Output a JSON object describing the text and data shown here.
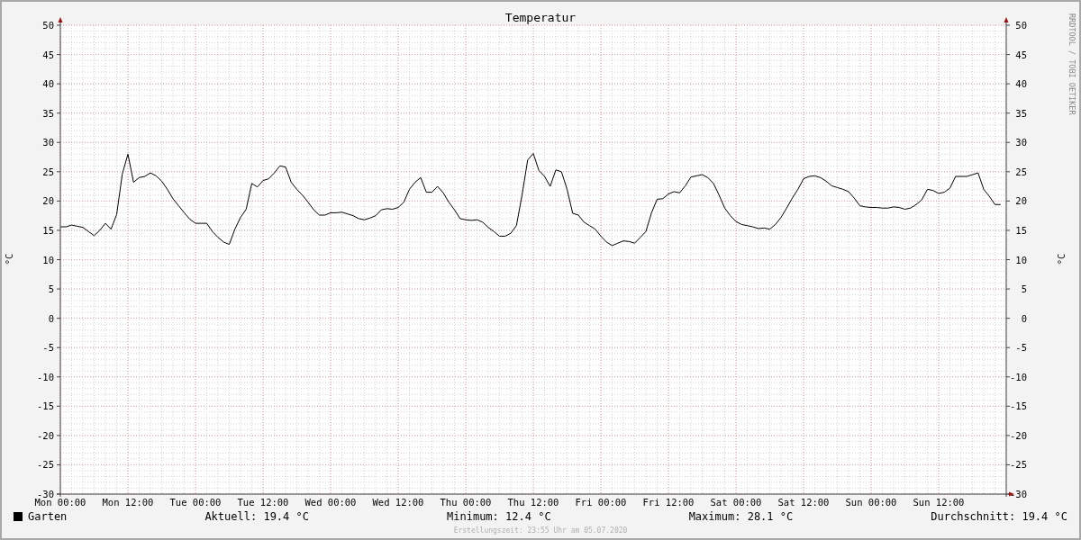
{
  "chart": {
    "watermark": "RRDTOOL / TOBI OETIKER",
    "right_axis": {
      "label": "°C",
      "ticks": [
        "50",
        "45",
        "40",
        "35",
        "30",
        "25",
        "20",
        "15",
        "10",
        "5",
        "0",
        "-5",
        "-10",
        "-15",
        "-20",
        "-25",
        "-30"
      ]
    },
    "chart_data": {
      "type": "line",
      "grid": true,
      "title": "Temperatur",
      "ylabel": "°C",
      "ylim": [
        -30,
        50
      ],
      "yticks": [
        {
          "value": 50,
          "label": "50"
        },
        {
          "value": 45,
          "label": "45"
        },
        {
          "value": 40,
          "label": "40"
        },
        {
          "value": 35,
          "label": "35"
        },
        {
          "value": 30,
          "label": "30"
        },
        {
          "value": 25,
          "label": "25"
        },
        {
          "value": 20,
          "label": "20"
        },
        {
          "value": 15,
          "label": "15"
        },
        {
          "value": 10,
          "label": "10"
        },
        {
          "value": 5,
          "label": "5"
        },
        {
          "value": 0,
          "label": "0"
        },
        {
          "value": -5,
          "label": "-5"
        },
        {
          "value": -10,
          "label": "-10"
        },
        {
          "value": -15,
          "label": "-15"
        },
        {
          "value": -20,
          "label": "-20"
        },
        {
          "value": -25,
          "label": "-25"
        },
        {
          "value": -30,
          "label": "-30"
        }
      ],
      "categories": [
        "Mon 00:00",
        null,
        null,
        null,
        null,
        null,
        null,
        null,
        null,
        null,
        null,
        null,
        "Mon 12:00",
        null,
        null,
        null,
        null,
        null,
        null,
        null,
        null,
        null,
        null,
        null,
        "Tue 00:00",
        null,
        null,
        null,
        null,
        null,
        null,
        null,
        null,
        null,
        null,
        null,
        "Tue 12:00",
        null,
        null,
        null,
        null,
        null,
        null,
        null,
        null,
        null,
        null,
        null,
        "Wed 00:00",
        null,
        null,
        null,
        null,
        null,
        null,
        null,
        null,
        null,
        null,
        null,
        "Wed 12:00",
        null,
        null,
        null,
        null,
        null,
        null,
        null,
        null,
        null,
        null,
        null,
        "Thu 00:00",
        null,
        null,
        null,
        null,
        null,
        null,
        null,
        null,
        null,
        null,
        null,
        "Thu 12:00",
        null,
        null,
        null,
        null,
        null,
        null,
        null,
        null,
        null,
        null,
        null,
        "Fri 00:00",
        null,
        null,
        null,
        null,
        null,
        null,
        null,
        null,
        null,
        null,
        null,
        "Fri 12:00",
        null,
        null,
        null,
        null,
        null,
        null,
        null,
        null,
        null,
        null,
        null,
        "Sat 00:00",
        null,
        null,
        null,
        null,
        null,
        null,
        null,
        null,
        null,
        null,
        null,
        "Sat 12:00",
        null,
        null,
        null,
        null,
        null,
        null,
        null,
        null,
        null,
        null,
        null,
        "Sun 00:00",
        null,
        null,
        null,
        null,
        null,
        null,
        null,
        null,
        null,
        null,
        null,
        "Sun 12:00",
        null,
        null,
        null,
        null,
        null,
        null,
        null,
        null,
        null,
        null,
        null
      ],
      "series": [
        {
          "name": "Garten",
          "color": "#000000",
          "values": [
            15.6,
            15.6,
            15.9,
            15.7,
            15.5,
            14.8,
            14.1,
            15.0,
            16.2,
            15.2,
            17.7,
            24.6,
            28.0,
            23.2,
            24.0,
            24.2,
            24.8,
            24.3,
            23.4,
            22.0,
            20.4,
            19.2,
            18.0,
            16.9,
            16.2,
            16.2,
            16.2,
            14.8,
            13.8,
            13.0,
            12.6,
            15.2,
            17.2,
            18.6,
            23.0,
            22.4,
            23.5,
            23.8,
            24.8,
            26.0,
            25.8,
            23.2,
            22.0,
            21.0,
            19.8,
            18.5,
            17.6,
            17.6,
            18.0,
            18.0,
            18.1,
            17.8,
            17.5,
            17.0,
            16.8,
            17.1,
            17.5,
            18.5,
            18.7,
            18.6,
            18.9,
            19.8,
            22.0,
            23.2,
            24.0,
            21.5,
            21.5,
            22.5,
            21.4,
            19.8,
            18.5,
            17.0,
            16.8,
            16.7,
            16.8,
            16.4,
            15.5,
            14.8,
            14.0,
            14.0,
            14.5,
            15.8,
            21.0,
            27.0,
            28.1,
            25.2,
            24.2,
            22.5,
            25.3,
            25.0,
            22.0,
            17.9,
            17.6,
            16.4,
            15.8,
            15.2,
            14.0,
            13.0,
            12.4,
            12.8,
            13.2,
            13.1,
            12.8,
            13.8,
            14.8,
            18.0,
            20.3,
            20.4,
            21.2,
            21.6,
            21.4,
            22.6,
            24.1,
            24.3,
            24.5,
            24.0,
            23.0,
            21.0,
            18.8,
            17.5,
            16.5,
            16.0,
            15.8,
            15.6,
            15.3,
            15.4,
            15.2,
            16.0,
            17.2,
            18.8,
            20.5,
            22.0,
            23.8,
            24.2,
            24.3,
            24.0,
            23.4,
            22.6,
            22.3,
            22.0,
            21.6,
            20.5,
            19.2,
            19.0,
            18.9,
            18.9,
            18.8,
            18.8,
            19.0,
            18.9,
            18.6,
            18.8,
            19.4,
            20.2,
            22.0,
            21.8,
            21.3,
            21.5,
            22.2,
            24.2,
            24.2,
            24.2,
            24.5,
            24.8,
            22.0,
            20.8,
            19.4,
            19.4
          ]
        }
      ]
    }
  },
  "legend": {
    "stats": [
      "Aktuell: 19.4 °C",
      "Minimum: 12.4 °C",
      "Maximum: 28.1 °C",
      "Durchschnitt: 19.4 °C"
    ]
  },
  "footer": "Erstellungszeit: 23:55 Uhr am 05.07.2020"
}
